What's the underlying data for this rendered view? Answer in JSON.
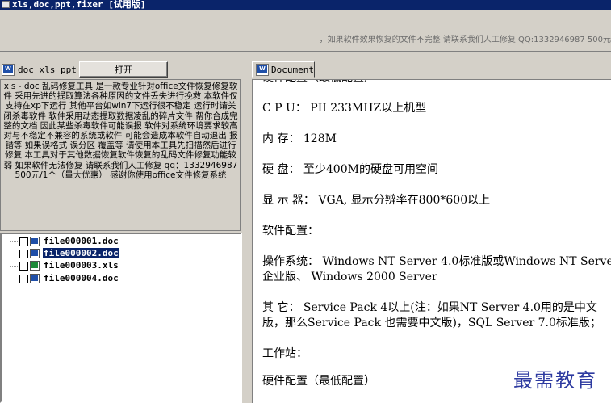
{
  "window": {
    "title": "xls,doc,ppt,fixer [试用版]",
    "notice": "，如果软件效果恢复的文件不完整 请联系我们人工修复 QQ:1332946987 500元"
  },
  "left_panel": {
    "tab_label": "doc xls ppt",
    "open_button": "打开",
    "description": "xls - doc 乱码修复工具 是一款专业针对office文件恢复修复软件 采用先进的提取算法各种原因的文件丢失进行挽救 本软件仅支持在xp下运行 其他平台如win7下运行很不稳定 运行时请关闭杀毒软件 软件采用动态提取数据凌乱的碎片文件 帮你合成完整的文档 因此某些杀毒软件可能误报 软件对系统环境要求较高 对与不稳定不兼容的系统或软件 可能会造成本软件自动退出 报错等 如果误格式 误分区 覆盖等 请使用本工具先扫描然后进行修复 本工具对于其他数据恢复软件恢复的乱码文件修复功能较弱 如果软件无法修复 请联系我们人工修复 qq：1332946987 500元/1个（量大优惠） 感谢你使用office文件修复系统"
  },
  "files": [
    {
      "name": "file000001.doc",
      "type": "doc",
      "selected": false
    },
    {
      "name": "file000002.doc",
      "type": "doc",
      "selected": true
    },
    {
      "name": "file000003.xls",
      "type": "xls",
      "selected": false
    },
    {
      "name": "file000004.doc",
      "type": "doc",
      "selected": false
    }
  ],
  "document": {
    "tab_label": "Document",
    "lines": [
      "硬件配置（最低配置）",
      "C P U：  PII 233MHZ以上机型",
      "内  存：   128M",
      "硬  盘：   至少400M的硬盘可用空间",
      "显  示  器：  VGA, 显示分辨率在800*600以上",
      "软件配置：",
      "操作系统：   Windows NT Server 4.0标准版或Windows NT Server4.0",
      "企业版、   Windows 2000 Server",
      "其  它：   Service Pack 4以上(注：如果NT Server 4.0用的是中文",
      "版，那么Service Pack 也需要中文版)，SQL Server 7.0标准版；",
      "工作站：",
      "硬件配置（最低配置）"
    ]
  },
  "watermark": "最需教育",
  "colors": {
    "title_bar": "#0a246a",
    "selection": "#0a246a",
    "watermark": "#2d3aa0",
    "xls_icon": "#1e8a3a",
    "doc_icon": "#1f4fa8"
  }
}
